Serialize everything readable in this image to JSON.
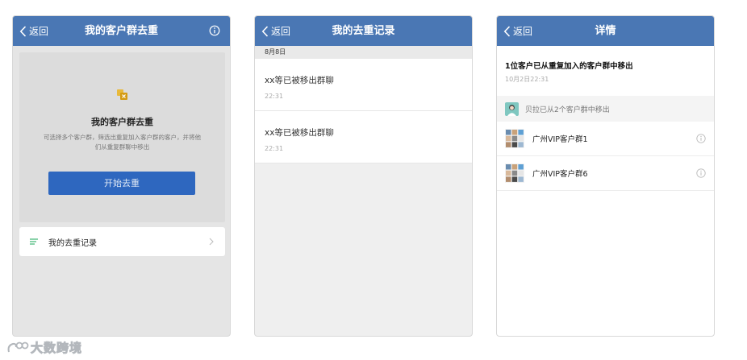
{
  "colors": {
    "navbar": "#4a77b4",
    "primary_button": "#2e67bf",
    "accent_green": "#3cb371",
    "logo_gold": "#d4a017"
  },
  "screen1": {
    "back_label": "返回",
    "title": "我的客户群去重",
    "info_icon": "info-circle-icon",
    "card": {
      "icon": "dedupe-icon",
      "title": "我的客户群去重",
      "description": "可选择多个客户群，筛选出重复加入客户群的客户，并将他们从重复群聊中移出",
      "start_button": "开始去重"
    },
    "record_row": {
      "icon": "list-icon",
      "label": "我的去重记录"
    }
  },
  "screen2": {
    "back_label": "返回",
    "title": "我的去重记录",
    "date_header": "8月8日",
    "records": [
      {
        "text": "xx等已被移出群聊",
        "time": "22:31"
      },
      {
        "text": "xx等已被移出群聊",
        "time": "22:31"
      }
    ]
  },
  "screen3": {
    "back_label": "返回",
    "title": "详情",
    "summary_title": "1位客户已从重复加入的客户群中移出",
    "summary_time": "10月2日22:31",
    "removed_text": "贝拉已从2个客户群中移出",
    "groups": [
      {
        "name": "广州VIP客户群1"
      },
      {
        "name": "广州VIP客户群6"
      }
    ]
  },
  "watermark": {
    "text": "大数跨境"
  }
}
